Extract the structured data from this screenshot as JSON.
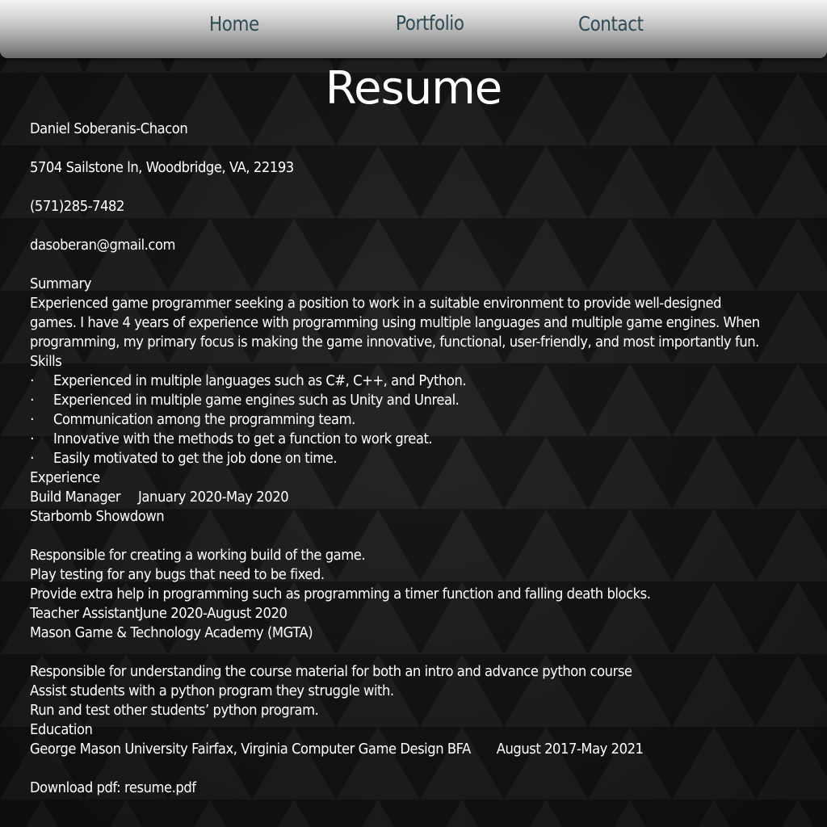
{
  "nav": {
    "home": "Home",
    "portfolio": "Portfolio",
    "contact": "Contact"
  },
  "page": {
    "title": "Resume"
  },
  "contact_info": {
    "name": "Daniel Soberanis-Chacon",
    "address": "5704 Sailstone ln, Woodbridge, VA, 22193",
    "phone": "(571)285-7482",
    "email": "dasoberan@gmail.com"
  },
  "summary": {
    "heading": "Summary",
    "lines": [
      "Experienced game programmer seeking a position to work in a suitable environment to provide well-designed",
      "games. I have 4 years of experience with programming using multiple languages and multiple game engines. When",
      "programming, my primary focus is making the game innovative, functional, user-friendly, and most importantly fun."
    ]
  },
  "skills": {
    "heading": "Skills",
    "bullet": "·",
    "items": [
      "Experienced in multiple languages such as C#, C++, and Python.",
      "Experienced in multiple game engines such as Unity and Unreal.",
      "Communication among the programming team.",
      "Innovative with the methods to get a function to work great.",
      "Easily motivated to get the job done on time."
    ]
  },
  "experience": {
    "heading": "Experience",
    "jobs": [
      {
        "title": "Build Manager",
        "dates": "January 2020-May 2020",
        "org": "Starbomb Showdown",
        "duties": [
          "Responsible for creating a working build of the game.",
          "Play testing for any bugs that need to be fixed.",
          "Provide extra help in programming such as programming a timer function and falling death blocks."
        ]
      },
      {
        "title": "Teacher Assistant",
        "dates": "June 2020-August 2020",
        "org": "Mason Game & Technology Academy (MGTA)",
        "duties": [
          "Responsible for understanding the course material for both an intro and advance python course",
          "Assist students with a python program they struggle with.",
          "Run and test other students’ python program."
        ]
      }
    ]
  },
  "education": {
    "heading": "Education",
    "entry": "George Mason University Fairfax, Virginia Computer Game Design BFA",
    "dates": "August 2017-May 2021"
  },
  "download": {
    "label": "Download pdf: ",
    "link_text": "resume.pdf"
  }
}
